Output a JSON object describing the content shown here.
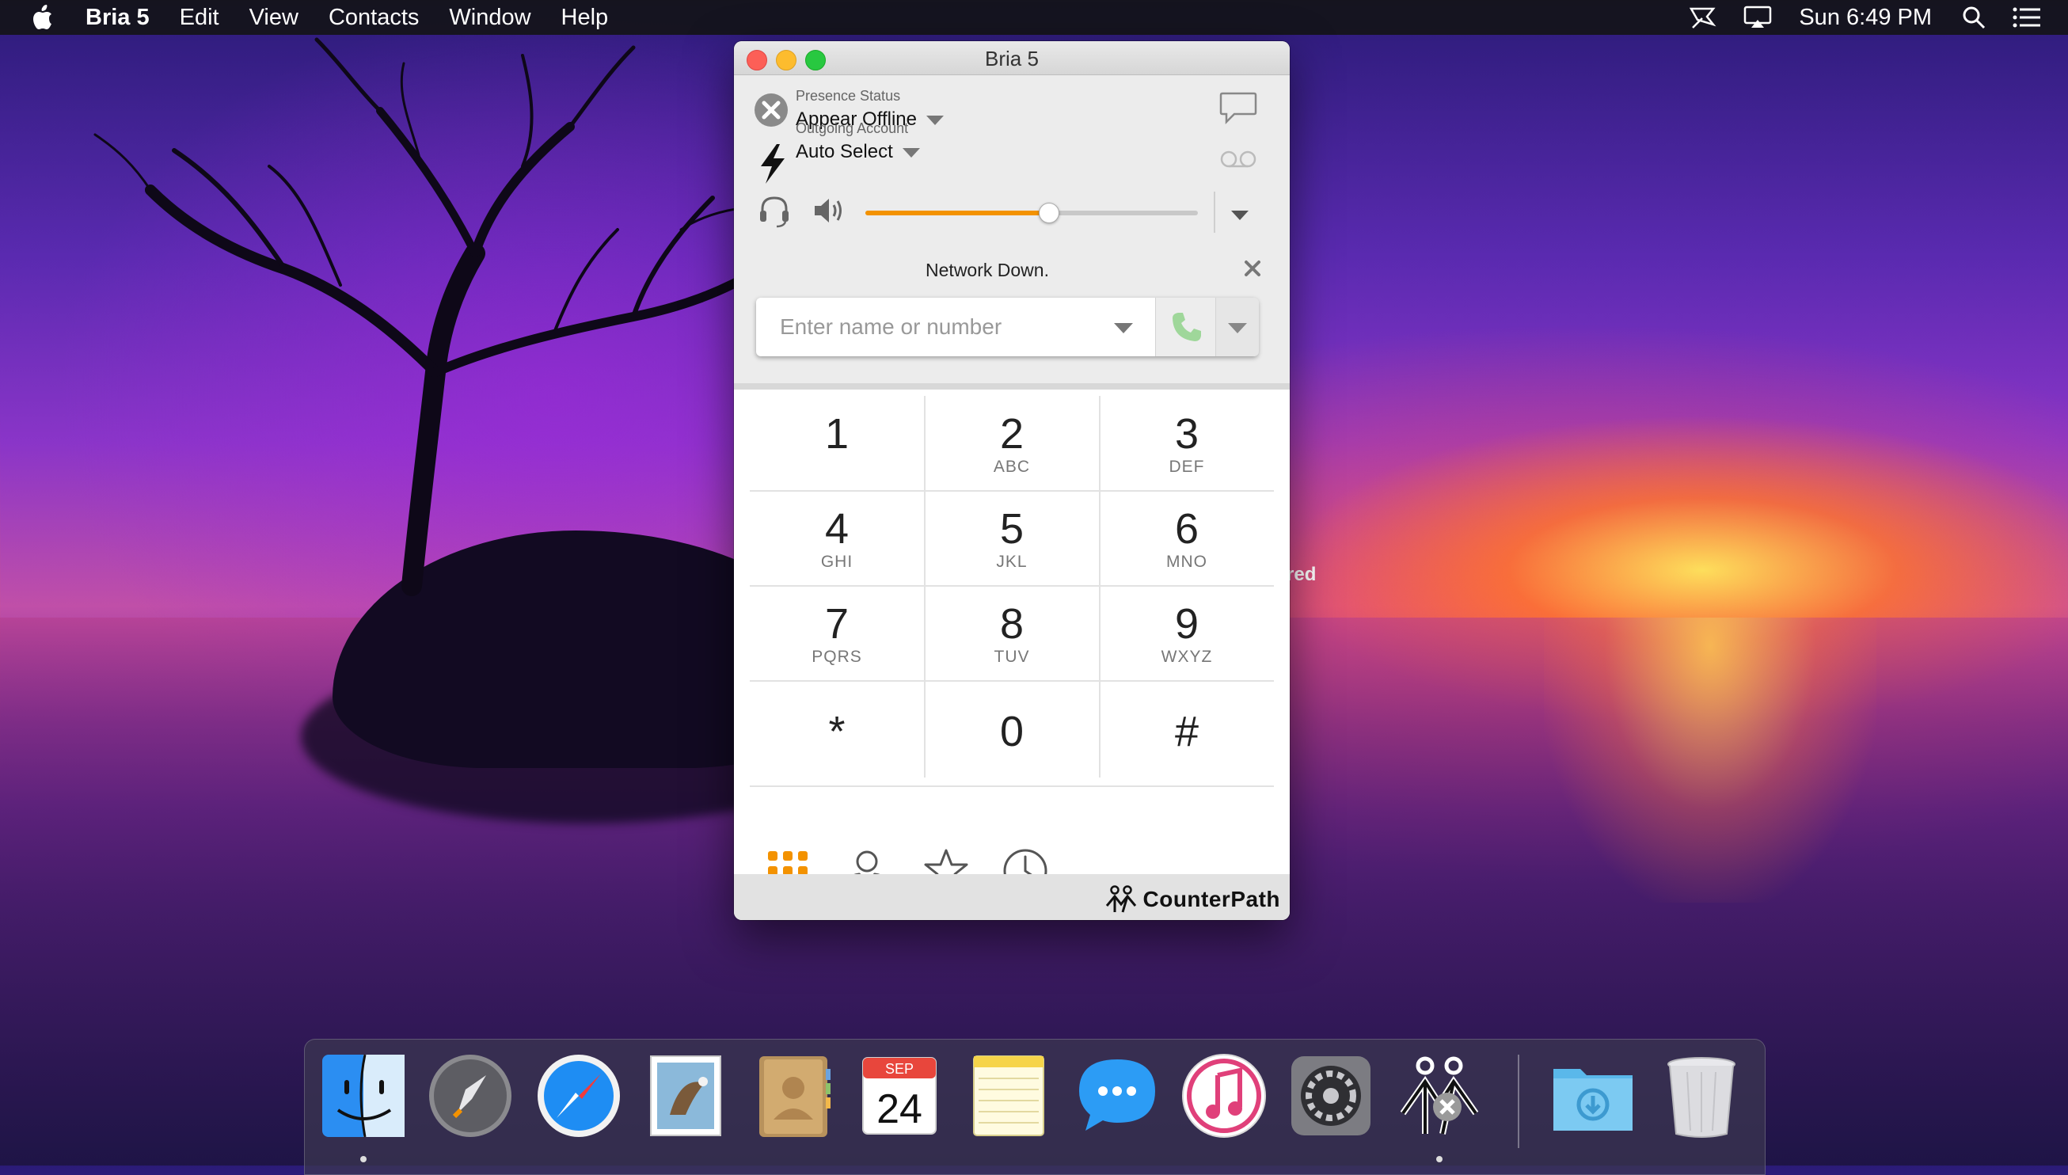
{
  "menubar": {
    "app_name": "Bria 5",
    "items": [
      "Edit",
      "View",
      "Contacts",
      "Window",
      "Help"
    ],
    "clock": "Sun 6:49 PM"
  },
  "desktop": {
    "partial_text": "red"
  },
  "window": {
    "title": "Bria 5",
    "presence": {
      "label": "Presence Status",
      "value": "Appear Offline"
    },
    "account": {
      "label": "Outgoing Account",
      "value": "Auto Select"
    },
    "volume_level": 0.55,
    "status_message": "Network Down.",
    "dial": {
      "placeholder": "Enter name or number"
    },
    "keypad": [
      {
        "digit": "1",
        "letters": ""
      },
      {
        "digit": "2",
        "letters": "ABC"
      },
      {
        "digit": "3",
        "letters": "DEF"
      },
      {
        "digit": "4",
        "letters": "GHI"
      },
      {
        "digit": "5",
        "letters": "JKL"
      },
      {
        "digit": "6",
        "letters": "MNO"
      },
      {
        "digit": "7",
        "letters": "PQRS"
      },
      {
        "digit": "8",
        "letters": "TUV"
      },
      {
        "digit": "9",
        "letters": "WXYZ"
      },
      {
        "digit": "*",
        "letters": ""
      },
      {
        "digit": "0",
        "letters": ""
      },
      {
        "digit": "#",
        "letters": ""
      }
    ],
    "bottom_nav": [
      "dialpad-icon",
      "contacts-icon",
      "favorites-icon",
      "history-icon"
    ],
    "footer_logo": "CounterPath",
    "accent_color": "#f39200"
  },
  "dock": {
    "apps": [
      "finder-icon",
      "launchpad-icon",
      "safari-icon",
      "mail-icon",
      "contacts-icon",
      "calendar-icon",
      "notes-icon",
      "messages-icon",
      "itunes-icon",
      "system-preferences-icon",
      "bria-icon",
      "downloads-icon",
      "trash-icon"
    ],
    "calendar": {
      "month": "SEP",
      "day": "24"
    }
  }
}
